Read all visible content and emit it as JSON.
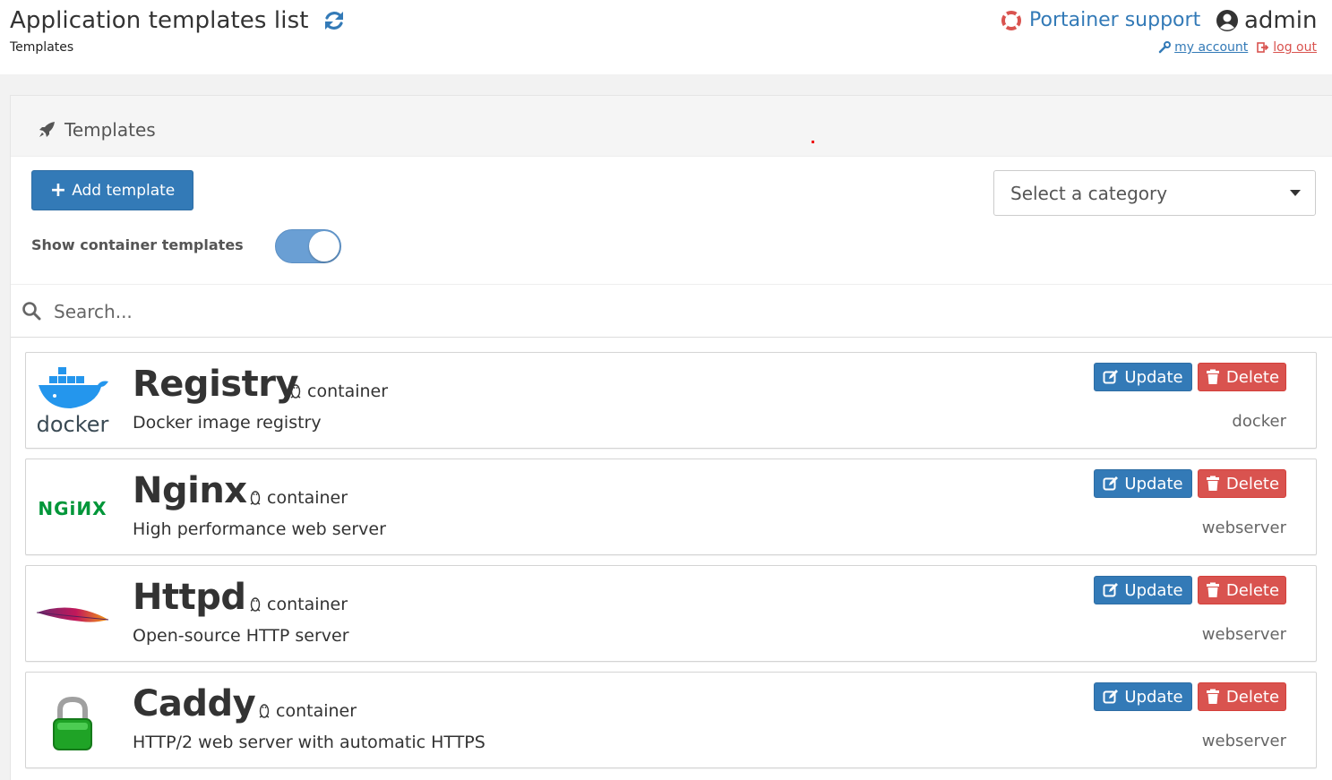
{
  "header": {
    "title": "Application templates list",
    "breadcrumb": "Templates",
    "support_label": "Portainer support",
    "username": "admin",
    "my_account_label": "my account",
    "log_out_label": "log out"
  },
  "panel": {
    "title": "Templates",
    "add_button_label": "Add template",
    "category_placeholder": "Select a category",
    "toggle_label": "Show container templates",
    "toggle_on": true,
    "search_placeholder": "Search..."
  },
  "templates": [
    {
      "name": "Registry",
      "type": "container",
      "description": "Docker image registry",
      "category": "docker",
      "logo": "docker-logo"
    },
    {
      "name": "Nginx",
      "type": "container",
      "description": "High performance web server",
      "category": "webserver",
      "logo": "nginx-logo"
    },
    {
      "name": "Httpd",
      "type": "container",
      "description": "Open-source HTTP server",
      "category": "webserver",
      "logo": "apache-feather-logo"
    },
    {
      "name": "Caddy",
      "type": "container",
      "description": "HTTP/2 web server with automatic HTTPS",
      "category": "webserver",
      "logo": "padlock-logo"
    }
  ],
  "actions": {
    "update_label": "Update",
    "delete_label": "Delete"
  },
  "logo_text": {
    "docker": "docker",
    "nginx": "NGiИX"
  },
  "colors": {
    "primary": "#337ab7",
    "danger": "#d9534f",
    "toggle": "#6a9fd4",
    "nginx_green": "#009639",
    "docker_blue": "#2496ed"
  }
}
